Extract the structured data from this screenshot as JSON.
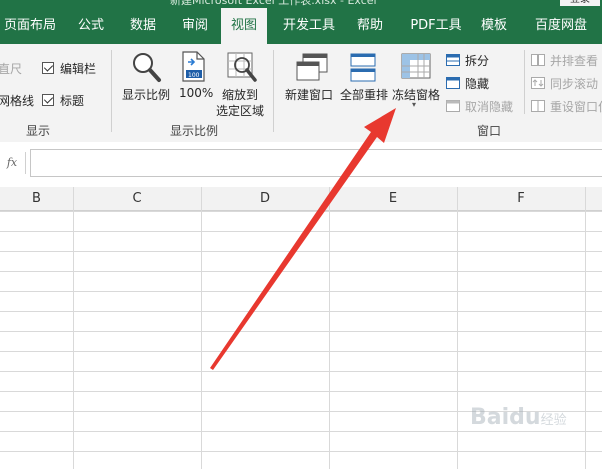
{
  "window": {
    "title": "新建Microsoft Excel 工作表.xlsx - Excel",
    "top_right_button": "登录"
  },
  "tabs": [
    "页面布局",
    "公式",
    "数据",
    "审阅",
    "视图",
    "开发工具",
    "帮助",
    "PDF工具",
    "模板",
    "百度网盘"
  ],
  "active_tab": "视图",
  "ribbon": {
    "show_group": {
      "ruler": "直尺",
      "gridlines": "网格线",
      "formula_bar": "编辑栏",
      "headings": "标题",
      "label": "显示"
    },
    "zoom_group": {
      "zoom": "显示比例",
      "zoom_100": "100%",
      "zoom_selection_line1": "缩放到",
      "zoom_selection_line2": "选定区域",
      "label": "显示比例"
    },
    "window_group": {
      "new_window": "新建窗口",
      "arrange_all": "全部重排",
      "freeze_panes": "冻结窗格",
      "split": "拆分",
      "hide": "隐藏",
      "unhide": "取消隐藏",
      "view_side_by_side": "并排查看",
      "sync_scroll": "同步滚动",
      "reset_position": "重设窗口位",
      "label": "窗口"
    }
  },
  "formula_bar": {
    "fx_label": "fx",
    "value": ""
  },
  "columns": [
    "B",
    "C",
    "D",
    "E",
    "F"
  ],
  "watermark": {
    "brand": "Baidu",
    "suffix": "经验"
  },
  "colors": {
    "accent": "#217346",
    "ribbon_bg": "#f3f3f3",
    "arrow": "#e8382f"
  }
}
